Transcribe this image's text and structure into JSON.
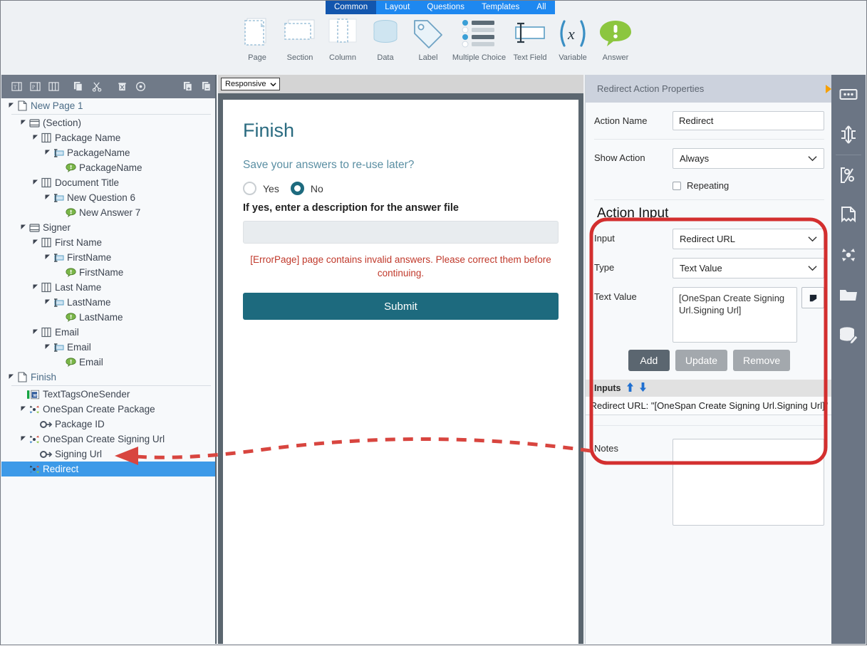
{
  "ribbon": {
    "tabs": [
      {
        "label": "Common",
        "active": true
      },
      {
        "label": "Layout",
        "active": false
      },
      {
        "label": "Questions",
        "active": false
      },
      {
        "label": "Templates",
        "active": false
      },
      {
        "label": "All",
        "active": false
      }
    ],
    "items": [
      {
        "label": "Page",
        "icon": "page-icon"
      },
      {
        "label": "Section",
        "icon": "section-icon"
      },
      {
        "label": "Column",
        "icon": "column-icon"
      },
      {
        "label": "Data",
        "icon": "database-icon"
      },
      {
        "label": "Label",
        "icon": "tag-icon"
      },
      {
        "label": "Multiple Choice",
        "icon": "list-icon"
      },
      {
        "label": "Text Field",
        "icon": "textfield-icon"
      },
      {
        "label": "Variable",
        "icon": "variable-icon"
      },
      {
        "label": "Answer",
        "icon": "answer-icon"
      }
    ]
  },
  "tree_toolbar": {
    "buttons": [
      {
        "name": "table-layout-icon"
      },
      {
        "name": "page-layout-icon"
      },
      {
        "name": "columns-layout-icon"
      },
      {
        "name": "copy-icon"
      },
      {
        "name": "cut-icon"
      },
      {
        "name": "delete-icon"
      },
      {
        "name": "info-icon"
      },
      {
        "name": "expand-all-icon"
      },
      {
        "name": "collapse-all-icon"
      }
    ]
  },
  "tree": {
    "nodes": [
      {
        "label": "New Page 1",
        "indent": 0,
        "arrow": true,
        "icon": "page-icon",
        "style": "page"
      },
      {
        "label": "(Section)",
        "indent": 1,
        "arrow": true,
        "icon": "section-icon",
        "style": "normal"
      },
      {
        "label": "Package Name",
        "indent": 2,
        "arrow": true,
        "icon": "column-icon",
        "style": "normal"
      },
      {
        "label": "PackageName",
        "indent": 3,
        "arrow": true,
        "icon": "textfield-icon",
        "style": "normal"
      },
      {
        "label": "PackageName",
        "indent": 4,
        "arrow": false,
        "icon": "answer-icon",
        "style": "normal"
      },
      {
        "label": "Document Title",
        "indent": 2,
        "arrow": true,
        "icon": "column-icon",
        "style": "normal"
      },
      {
        "label": "New Question 6",
        "indent": 3,
        "arrow": true,
        "icon": "textfield-icon",
        "style": "normal"
      },
      {
        "label": "New Answer 7",
        "indent": 4,
        "arrow": false,
        "icon": "answer-icon",
        "style": "normal"
      },
      {
        "label": "Signer",
        "indent": 1,
        "arrow": true,
        "icon": "section-icon",
        "style": "normal"
      },
      {
        "label": "First Name",
        "indent": 2,
        "arrow": true,
        "icon": "column-icon",
        "style": "normal"
      },
      {
        "label": "FirstName",
        "indent": 3,
        "arrow": true,
        "icon": "textfield-icon",
        "style": "normal"
      },
      {
        "label": "FirstName",
        "indent": 4,
        "arrow": false,
        "icon": "answer-icon",
        "style": "normal"
      },
      {
        "label": "Last Name",
        "indent": 2,
        "arrow": true,
        "icon": "column-icon",
        "style": "normal"
      },
      {
        "label": "LastName",
        "indent": 3,
        "arrow": true,
        "icon": "textfield-icon",
        "style": "normal"
      },
      {
        "label": "LastName",
        "indent": 4,
        "arrow": false,
        "icon": "answer-icon",
        "style": "normal"
      },
      {
        "label": "Email",
        "indent": 2,
        "arrow": true,
        "icon": "column-icon",
        "style": "normal"
      },
      {
        "label": "Email",
        "indent": 3,
        "arrow": true,
        "icon": "textfield-icon",
        "style": "normal"
      },
      {
        "label": "Email",
        "indent": 4,
        "arrow": false,
        "icon": "answer-icon",
        "style": "normal"
      },
      {
        "label": "Finish",
        "indent": 0,
        "arrow": true,
        "icon": "page-icon",
        "style": "page",
        "separator_after": true
      },
      {
        "label": "TextTagsOneSender",
        "indent": 1,
        "arrow": false,
        "icon": "word-doc-icon",
        "style": "normal"
      },
      {
        "label": "OneSpan Create Package",
        "indent": 1,
        "arrow": true,
        "icon": "action-icon",
        "style": "normal"
      },
      {
        "label": "Package ID",
        "indent": 2,
        "arrow": false,
        "icon": "output-icon",
        "style": "normal"
      },
      {
        "label": "OneSpan Create Signing Url",
        "indent": 1,
        "arrow": true,
        "icon": "action-icon",
        "style": "normal"
      },
      {
        "label": "Signing Url",
        "indent": 2,
        "arrow": false,
        "icon": "output-icon",
        "style": "normal"
      },
      {
        "label": "Redirect",
        "indent": 1,
        "arrow": false,
        "icon": "action-icon",
        "style": "normal",
        "selected": true
      }
    ]
  },
  "preview": {
    "device_select": "Responsive",
    "title": "Finish",
    "question": "Save your answers to re-use later?",
    "radio_yes": "Yes",
    "radio_no": "No",
    "selected_radio": "No",
    "description_label": "If yes, enter a description for the answer file",
    "description_value": "",
    "error": "[ErrorPage] page contains invalid answers. Please correct them before continuing.",
    "submit_label": "Submit"
  },
  "properties": {
    "header": "Redirect Action Properties",
    "action_name_label": "Action Name",
    "action_name_value": "Redirect",
    "show_action_label": "Show Action",
    "show_action_value": "Always",
    "repeating_label": "Repeating",
    "repeating_checked": false,
    "action_input_title": "Action Input",
    "input_label": "Input",
    "input_value": "Redirect URL",
    "type_label": "Type",
    "type_value": "Text Value",
    "text_value_label": "Text Value",
    "text_value_value": "[OneSpan Create Signing Url.Signing Url]",
    "pick_button_icon": "flag-icon",
    "add_label": "Add",
    "update_label": "Update",
    "remove_label": "Remove",
    "inputs_header": "Inputs",
    "move_up_icon": "arrow-up-icon",
    "move_down_icon": "arrow-down-icon",
    "inputs_rows": [
      "Redirect URL: \"[OneSpan Create Signing Url.Signing Url]\""
    ],
    "notes_label": "Notes",
    "notes_value": ""
  },
  "rail": {
    "items": [
      {
        "name": "properties-panel-icon"
      },
      {
        "name": "rules-icon"
      },
      {
        "name": "code-percent-icon"
      },
      {
        "name": "document-icon"
      },
      {
        "name": "actions-icon"
      },
      {
        "name": "folder-icon"
      },
      {
        "name": "data-edit-icon"
      }
    ]
  },
  "colors": {
    "accent_blue": "#1e88f0",
    "tab_active": "#1256ae",
    "panel_dark": "#6b7584",
    "teal": "#1d6a7e",
    "annotation_red": "#d32f2f",
    "selection_blue": "#3d9ae8",
    "error_red": "#c0392b"
  }
}
